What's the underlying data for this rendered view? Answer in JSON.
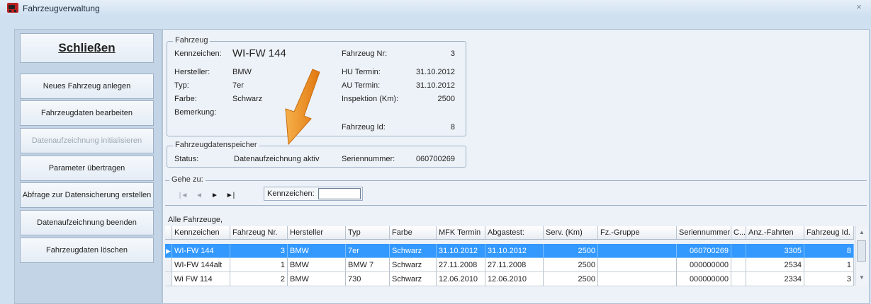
{
  "window": {
    "title": "Fahrzeugverwaltung",
    "close_icon": "×"
  },
  "sidebar": {
    "close_button": "Schließen",
    "buttons": [
      {
        "label": "Neues Fahrzeug anlegen",
        "enabled": true
      },
      {
        "label": "Fahrzeugdaten bearbeiten",
        "enabled": true
      },
      {
        "label": "Datenaufzeichnung initialisieren",
        "enabled": false
      },
      {
        "label": "Parameter übertragen",
        "enabled": true
      },
      {
        "label": "Abfrage zur Datensicherung erstellen",
        "enabled": true
      },
      {
        "label": "Datenaufzeichnung beenden",
        "enabled": true
      },
      {
        "label": "Fahrzeugdaten löschen",
        "enabled": true
      }
    ]
  },
  "vehicle": {
    "group_title": "Fahrzeug",
    "labels": {
      "plate": "Kennzeichen:",
      "manufacturer": "Hersteller:",
      "type": "Typ:",
      "color": "Farbe:",
      "remark": "Bemerkung:",
      "vehicle_no": "Fahrzeug Nr:",
      "hu": "HU Termin:",
      "au": "AU Termin:",
      "inspection": "Inspektion (Km):",
      "vehicle_id": "Fahrzeug Id:"
    },
    "values": {
      "plate": "WI-FW 144",
      "manufacturer": "BMW",
      "type": "7er",
      "color": "Schwarz",
      "vehicle_no": "3",
      "hu": "31.10.2012",
      "au": "31.10.2012",
      "inspection": "2500",
      "vehicle_id": "8"
    }
  },
  "recorder": {
    "group_title": "Fahrzeugdatenspeicher",
    "status_label": "Status:",
    "status_value": "Datenaufzeichnung aktiv",
    "serial_label": "Seriennummer:",
    "serial_value": "060700269"
  },
  "goto": {
    "group_title": "Gehe zu:",
    "nav_icons": [
      "first-icon",
      "prev-icon",
      "next-icon",
      "last-icon"
    ],
    "plate_label": "Kennzeichen:",
    "plate_value": ""
  },
  "grid": {
    "caption": "Alle Fahrzeuge,",
    "columns": [
      "Kennzeichen",
      "Fahrzeug Nr.",
      "Hersteller",
      "Typ",
      "Farbe",
      "MFK Termin",
      "Abgastest:",
      "Serv. (Km)",
      "Fz.-Gruppe",
      "Seriennummer",
      "C...",
      "Anz.-Fahrten",
      "Fahrzeug Id."
    ],
    "rows": [
      [
        "WI-FW 144",
        "3",
        "BMW",
        "7er",
        "Schwarz",
        "31.10.2012",
        "31.10.2012",
        "2500",
        "",
        "060700269",
        "",
        "3305",
        "8"
      ],
      [
        "WI-FW 144alt",
        "1",
        "BMW",
        "BMW 7",
        "Schwarz",
        "27.11.2008",
        "27.11.2008",
        "2500",
        "",
        "000000000",
        "",
        "2534",
        "1"
      ],
      [
        "Wi FW 114",
        "2",
        "BMW",
        "730",
        "Schwarz",
        "12.06.2010",
        "12.06.2010",
        "2500",
        "",
        "000000000",
        "",
        "2334",
        "3"
      ]
    ],
    "selected_row": 0
  },
  "colors": {
    "selection": "#3399ff",
    "arrow": "#f08a1c"
  }
}
